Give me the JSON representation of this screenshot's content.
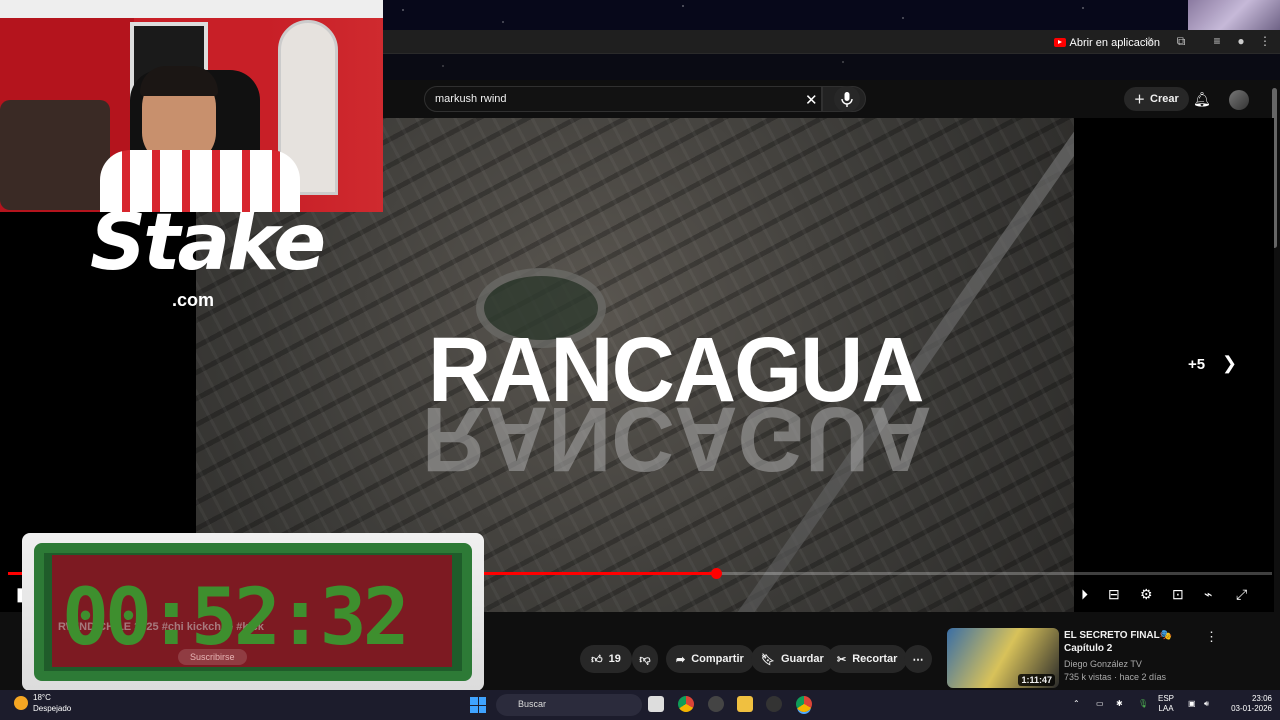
{
  "browser": {
    "open_in_app_label": "Abrir en aplicación"
  },
  "youtube": {
    "search": {
      "value": "markush rwind"
    },
    "create_label": "Crear"
  },
  "video": {
    "overlay_title": "RANCAGUA",
    "overlay_title_mirror": "RANCAGUA",
    "more_count": "+5",
    "progress_fraction": 0.56
  },
  "sponsor": {
    "brand": "Stake",
    "domain": ".com"
  },
  "actions": {
    "likes": "19",
    "share_label": "Compartir",
    "save_label": "Guardar",
    "clip_label": "Recortar"
  },
  "suggestion": {
    "title": "EL SECRETO FINAL🎭 Capítulo 2",
    "channel": "Diego González TV",
    "meta": "735 k vistas · hace 2 días",
    "duration": "1:11:47"
  },
  "timer": {
    "value": "00:52:32",
    "ghost_text": "RWIND CHILE 2025 #chi kickchile #kick",
    "subscribe_label": "Suscribirse"
  },
  "taskbar": {
    "temperature": "18°C",
    "weather": "Despejado",
    "search_label": "Buscar",
    "lang_1": "ESP",
    "lang_2": "LAA",
    "time": "23:06",
    "date": "03-01-2026"
  },
  "colors": {
    "accent_red": "#ff0000",
    "timer_green": "#3e8f2e"
  }
}
